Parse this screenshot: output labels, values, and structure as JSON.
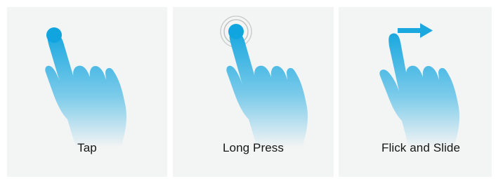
{
  "panels": [
    {
      "label": "Tap",
      "icon": "tap-gesture-icon"
    },
    {
      "label": "Long Press",
      "icon": "long-press-gesture-icon"
    },
    {
      "label": "Flick and Slide",
      "icon": "flick-slide-gesture-icon"
    }
  ],
  "colors": {
    "panel_bg": "#f3f4f4",
    "hand_top": "#1aa8df",
    "hand_bottom": "#f3f4f4",
    "touch_dot": "#11a5e0",
    "ring": "#b9bcbd",
    "arrow": "#1aa8df",
    "text": "#161616"
  }
}
